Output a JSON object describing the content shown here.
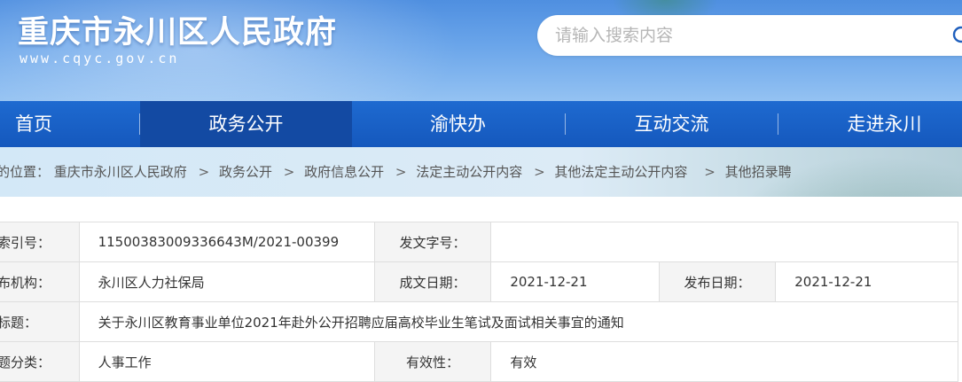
{
  "header": {
    "site_title": "重庆市永川区人民政府",
    "site_url": "www.cqyc.gov.cn"
  },
  "search": {
    "placeholder": "请输入搜索内容",
    "value": ""
  },
  "nav": {
    "items": [
      {
        "label": "首页"
      },
      {
        "label": "政务公开"
      },
      {
        "label": "渝快办"
      },
      {
        "label": "互动交流"
      },
      {
        "label": "走进永川"
      }
    ],
    "active": "政务公开"
  },
  "breadcrumb": {
    "prefix": "的位置：",
    "items": [
      "重庆市永川区人民政府",
      "政务公开",
      "政府信息公开",
      "法定主动公开内容",
      "其他法定主动公开内容",
      "其他招录聘"
    ],
    "separator": ">"
  },
  "info": {
    "index_label": "索引号：",
    "index_value": "11500383009336643M/2021-00399",
    "doc_no_label": "发文字号：",
    "doc_no_value": "",
    "publisher_label": "布机构：",
    "publisher_value": "永川区人力社保局",
    "created_label": "成文日期：",
    "created_value": "2021-12-21",
    "published_label": "发布日期：",
    "published_value": "2021-12-21",
    "title_label": "标题：",
    "title_value": "关于永川区教育事业单位2021年赴外公开招聘应届高校毕业生笔试及面试相关事宜的通知",
    "topic_label": "题分类：",
    "topic_value": "人事工作",
    "validity_label": "有效性：",
    "validity_value": "有效"
  },
  "colors": {
    "nav_bg": "#1558bd",
    "nav_active": "#134aa3",
    "header_bg": "#6aa5ea"
  },
  "icons": [
    "search-icon"
  ]
}
